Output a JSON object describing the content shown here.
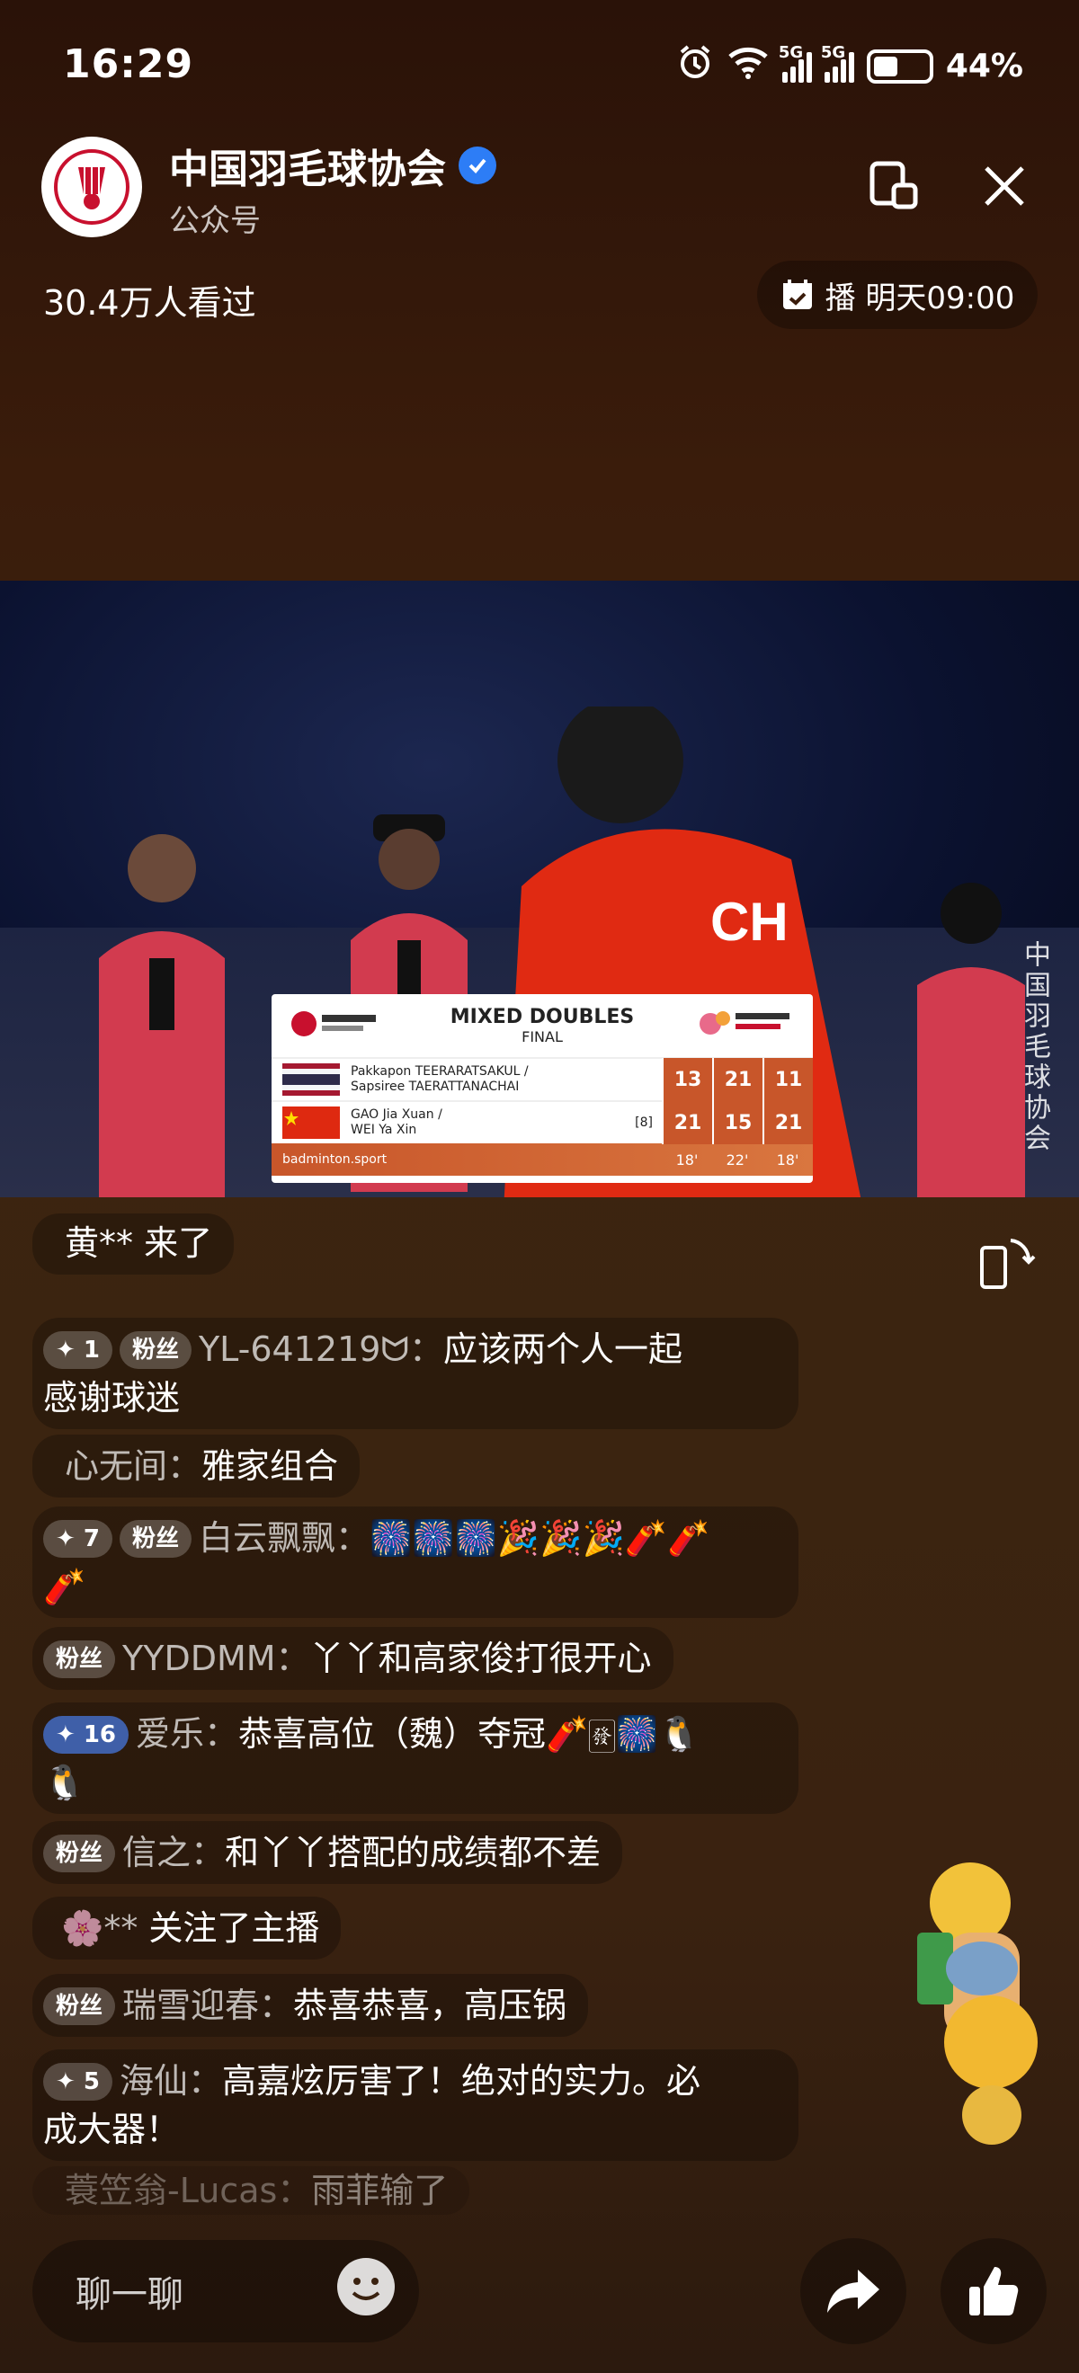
{
  "status_bar": {
    "time": "16:29",
    "net1": "5G",
    "net2": "5G",
    "battery": "44%",
    "battery_level": 0.44
  },
  "header": {
    "channel_name": "中国羽毛球协会",
    "channel_type": "公众号",
    "viewers": "30.4万人看过",
    "schedule_label": "播 明天09:00"
  },
  "scoreboard": {
    "event": "MIXED DOUBLES",
    "round": "FINAL",
    "players": [
      {
        "line1": "Pakkapon TEERARATSAKUL /",
        "line2": "Sapsiree TAERATTANACHAI",
        "seed": "",
        "scores": [
          "13",
          "21",
          "11"
        ]
      },
      {
        "line1": "GAO Jia Xuan /",
        "line2": "WEI Ya Xin",
        "seed": "[8]",
        "scores": [
          "21",
          "15",
          "21"
        ]
      }
    ],
    "website": "badminton.sport",
    "times": [
      "18'",
      "22'",
      "18'"
    ]
  },
  "watermark": "中国羽毛球协会",
  "chat": {
    "arrival": "黄** 来了",
    "messages": [
      {
        "level": "✦ 1",
        "fan": "粉丝",
        "user": "YL-641219ᗢ：",
        "text": "应该两个人一起"
      },
      {
        "text2": "感谢球迷"
      },
      {
        "user": "心无间：",
        "text": "雅家组合"
      },
      {
        "level": "✦ 7",
        "fan": "粉丝",
        "user": "白云飘飘：",
        "text": "🎆🎆🎆🎉🎉🎉🧨🧨"
      },
      {
        "text2": "🧨"
      },
      {
        "fan": "粉丝",
        "user": "YYDDMM：",
        "text": "丫丫和高家俊打很开心"
      },
      {
        "level": "✦ 16",
        "user": "爱乐：",
        "text": "恭喜高位（魏）夺冠🧨🀅🎆🐧"
      },
      {
        "text2": "🐧"
      },
      {
        "fan": "粉丝",
        "user": "信之：",
        "text": "和丫丫搭配的成绩都不差"
      },
      {
        "user": "🌸**",
        "text": " 关注了主播"
      },
      {
        "fan": "粉丝",
        "user": "瑞雪迎春：",
        "text": "恭喜恭喜，高压锅"
      },
      {
        "level": "✦ 5",
        "user": "海仙：",
        "text": "高嘉炫厉害了！绝对的实力。必"
      },
      {
        "text2": "成大器！"
      },
      {
        "user": "蓑笠翁-Lucas：",
        "text": "雨菲输了"
      }
    ]
  },
  "input": {
    "placeholder": "聊一聊"
  },
  "colors": {
    "accent_score": "#c8562a",
    "verified_blue": "#2d7df6"
  }
}
